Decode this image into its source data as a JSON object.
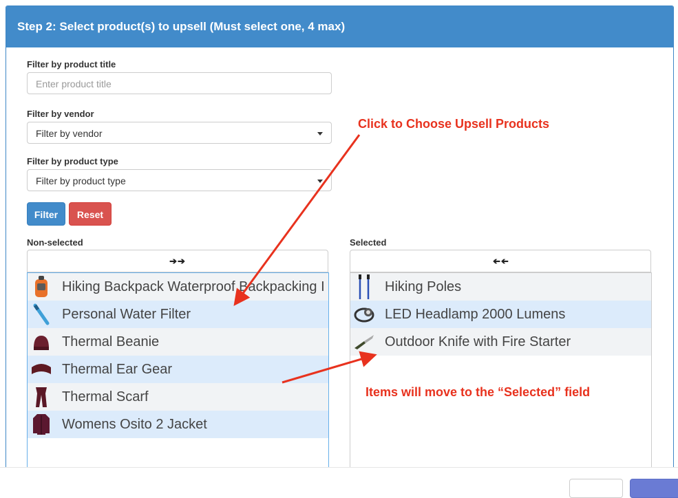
{
  "header": {
    "title": "Step 2: Select product(s) to upsell (Must select one, 4 max)"
  },
  "filters": {
    "title_label": "Filter by product title",
    "title_placeholder": "Enter product title",
    "vendor_label": "Filter by vendor",
    "vendor_value": "Filter by vendor",
    "type_label": "Filter by product type",
    "type_value": "Filter by product type",
    "filter_button": "Filter",
    "reset_button": "Reset"
  },
  "nonselected": {
    "label": "Non-selected",
    "move_all_icon": "double-right-arrow-icon",
    "items": [
      {
        "name": "Hiking Backpack Waterproof Backpacking I",
        "icon": "backpack-icon"
      },
      {
        "name": "Personal Water Filter",
        "icon": "water-filter-icon"
      },
      {
        "name": "Thermal Beanie",
        "icon": "beanie-icon"
      },
      {
        "name": "Thermal Ear Gear",
        "icon": "ear-gear-icon"
      },
      {
        "name": "Thermal Scarf",
        "icon": "scarf-icon"
      },
      {
        "name": "Womens Osito 2 Jacket",
        "icon": "jacket-icon"
      }
    ]
  },
  "selected": {
    "label": "Selected",
    "remove_all_icon": "double-left-arrow-icon",
    "items": [
      {
        "name": "Hiking Poles",
        "icon": "hiking-poles-icon"
      },
      {
        "name": "LED Headlamp 2000 Lumens",
        "icon": "headlamp-icon"
      },
      {
        "name": "Outdoor Knife with Fire Starter",
        "icon": "knife-icon"
      }
    ]
  },
  "annotations": {
    "choose": "Click to Choose Upsell Products",
    "move": "Items will move to the “Selected” field"
  },
  "colors": {
    "header": "#428bca",
    "filter": "#428bca",
    "reset": "#d9534f",
    "annotation": "#e8321e",
    "highlight": "#dcebfb"
  }
}
